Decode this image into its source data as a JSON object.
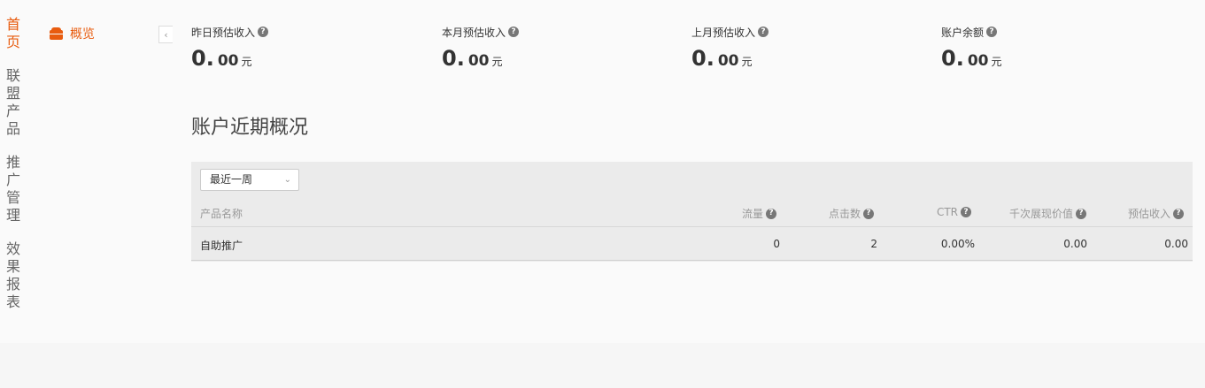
{
  "vnav": [
    {
      "label": "首页",
      "active": true
    },
    {
      "label": "联盟产品",
      "active": false
    },
    {
      "label": "推广管理",
      "active": false
    },
    {
      "label": "效果报表",
      "active": false
    }
  ],
  "subnav": {
    "overview_label": "概览"
  },
  "collapse_glyph": "‹",
  "stats": [
    {
      "label": "昨日预估收入",
      "int": "0.",
      "dec": "00",
      "unit": "元"
    },
    {
      "label": "本月预估收入",
      "int": "0.",
      "dec": "00",
      "unit": "元"
    },
    {
      "label": "上月预估收入",
      "int": "0.",
      "dec": "00",
      "unit": "元"
    },
    {
      "label": "账户余额",
      "int": "0.",
      "dec": "00",
      "unit": "元"
    }
  ],
  "help_glyph": "?",
  "section_title": "账户近期概况",
  "period_select": {
    "value": "最近一周",
    "chevron": "⌄"
  },
  "table": {
    "headers": [
      "产品名称",
      "流量",
      "点击数",
      "CTR",
      "千次展现价值",
      "预估收入"
    ],
    "rows": [
      [
        "自助推广",
        "0",
        "2",
        "0.00%",
        "0.00",
        "0.00"
      ]
    ]
  },
  "colors": {
    "accent": "#e85c0f",
    "panel_bg": "#ebebeb",
    "page_bg": "#fafafa"
  }
}
